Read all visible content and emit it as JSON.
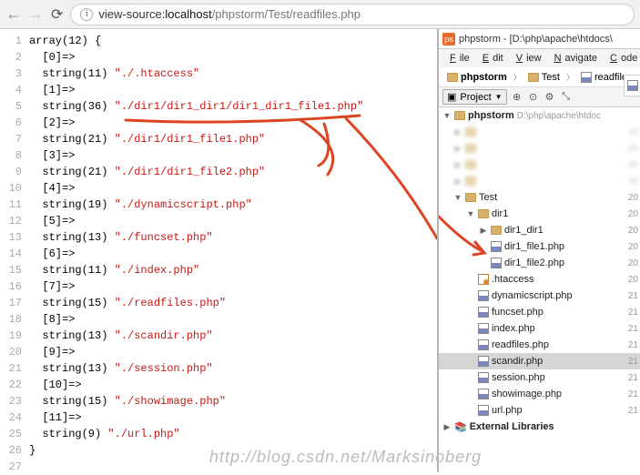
{
  "browser": {
    "url_prefix": "view-source:",
    "url_host": "localhost",
    "url_path": "/phpstorm/Test/readfiles.php"
  },
  "source": {
    "lines": [
      "array(12) {",
      "  [0]=>",
      "  string(11) \"./.htaccess\"",
      "  [1]=>",
      "  string(36) \"./dir1/dir1_dir1/dir1_dir1_file1.php\"",
      "  [2]=>",
      "  string(21) \"./dir1/dir1_file1.php\"",
      "  [3]=>",
      "  string(21) \"./dir1/dir1_file2.php\"",
      "  [4]=>",
      "  string(19) \"./dynamicscript.php\"",
      "  [5]=>",
      "  string(13) \"./funcset.php\"",
      "  [6]=>",
      "  string(11) \"./index.php\"",
      "  [7]=>",
      "  string(15) \"./readfiles.php\"",
      "  [8]=>",
      "  string(13) \"./scandir.php\"",
      "  [9]=>",
      "  string(13) \"./session.php\"",
      "  [10]=>",
      "  string(15) \"./showimage.php\"",
      "  [11]=>",
      "  string(9) \"./url.php\"",
      "}",
      ""
    ]
  },
  "ide": {
    "title": "phpstorm - [D:\\php\\apache\\htdocs\\",
    "menu": [
      "File",
      "Edit",
      "View",
      "Navigate",
      "Code"
    ],
    "breadcrumb": [
      "phpstorm",
      "Test",
      "readfiles"
    ],
    "project_label": "Project",
    "tree": [
      {
        "depth": 0,
        "arrow": "down",
        "icon": "folder",
        "label": "phpstorm",
        "note": "D:\\php\\apache\\htdoc",
        "rn": ""
      },
      {
        "depth": 1,
        "arrow": "right",
        "icon": "folder",
        "label": "",
        "note": "",
        "rn": "19",
        "blur": true
      },
      {
        "depth": 1,
        "arrow": "right",
        "icon": "folder",
        "label": "",
        "note": "",
        "rn": "20",
        "blur": true
      },
      {
        "depth": 1,
        "arrow": "right",
        "icon": "folder",
        "label": "",
        "note": "",
        "rn": "20",
        "blur": true
      },
      {
        "depth": 1,
        "arrow": "right",
        "icon": "folder",
        "label": "",
        "note": "",
        "rn": "20",
        "blur": true
      },
      {
        "depth": 1,
        "arrow": "down",
        "icon": "folder",
        "label": "Test",
        "note": "",
        "rn": "20"
      },
      {
        "depth": 2,
        "arrow": "down",
        "icon": "folder",
        "label": "dir1",
        "note": "",
        "rn": "20"
      },
      {
        "depth": 3,
        "arrow": "right",
        "icon": "folder",
        "label": "dir1_dir1",
        "note": "",
        "rn": "20"
      },
      {
        "depth": 3,
        "arrow": "none",
        "icon": "php",
        "label": "dir1_file1.php",
        "note": "",
        "rn": "20"
      },
      {
        "depth": 3,
        "arrow": "none",
        "icon": "php",
        "label": "dir1_file2.php",
        "note": "",
        "rn": "20"
      },
      {
        "depth": 2,
        "arrow": "none",
        "icon": "htaccess",
        "label": ".htaccess",
        "note": "",
        "rn": "20"
      },
      {
        "depth": 2,
        "arrow": "none",
        "icon": "php",
        "label": "dynamicscript.php",
        "note": "",
        "rn": "21"
      },
      {
        "depth": 2,
        "arrow": "none",
        "icon": "php",
        "label": "funcset.php",
        "note": "",
        "rn": "21"
      },
      {
        "depth": 2,
        "arrow": "none",
        "icon": "php",
        "label": "index.php",
        "note": "",
        "rn": "21"
      },
      {
        "depth": 2,
        "arrow": "none",
        "icon": "php",
        "label": "readfiles.php",
        "note": "",
        "rn": "21"
      },
      {
        "depth": 2,
        "arrow": "none",
        "icon": "php",
        "label": "scandir.php",
        "note": "",
        "rn": "21",
        "selected": true
      },
      {
        "depth": 2,
        "arrow": "none",
        "icon": "php",
        "label": "session.php",
        "note": "",
        "rn": "21"
      },
      {
        "depth": 2,
        "arrow": "none",
        "icon": "php",
        "label": "showimage.php",
        "note": "",
        "rn": "21"
      },
      {
        "depth": 2,
        "arrow": "none",
        "icon": "php",
        "label": "url.php",
        "note": "",
        "rn": "21"
      },
      {
        "depth": 0,
        "arrow": "right",
        "icon": "lib",
        "label": "External Libraries",
        "note": "",
        "rn": ""
      }
    ]
  },
  "watermark": "http://blog.csdn.net/Marksinoberg"
}
